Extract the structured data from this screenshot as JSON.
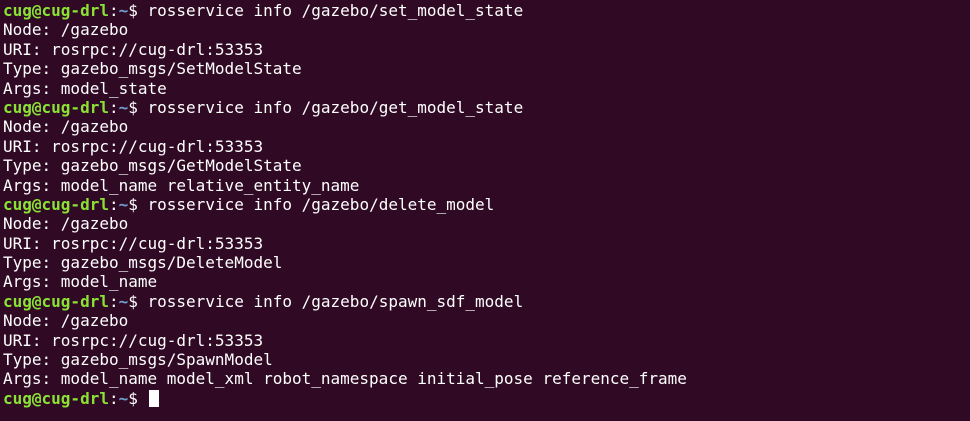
{
  "prompt": {
    "user_host": "cug@cug-drl",
    "separator": ":",
    "cwd": "~",
    "symbol": "$ "
  },
  "blocks": [
    {
      "command": "rosservice info /gazebo/set_model_state",
      "output": [
        "Node: /gazebo",
        "URI: rosrpc://cug-drl:53353",
        "Type: gazebo_msgs/SetModelState",
        "Args: model_state"
      ]
    },
    {
      "command": "rosservice info /gazebo/get_model_state",
      "output": [
        "Node: /gazebo",
        "URI: rosrpc://cug-drl:53353",
        "Type: gazebo_msgs/GetModelState",
        "Args: model_name relative_entity_name"
      ]
    },
    {
      "command": "rosservice info /gazebo/delete_model",
      "output": [
        "Node: /gazebo",
        "URI: rosrpc://cug-drl:53353",
        "Type: gazebo_msgs/DeleteModel",
        "Args: model_name"
      ]
    },
    {
      "command": "rosservice info /gazebo/spawn_sdf_model",
      "output": [
        "Node: /gazebo",
        "URI: rosrpc://cug-drl:53353",
        "Type: gazebo_msgs/SpawnModel",
        "Args: model_name model_xml robot_namespace initial_pose reference_frame"
      ]
    }
  ],
  "final_command": ""
}
